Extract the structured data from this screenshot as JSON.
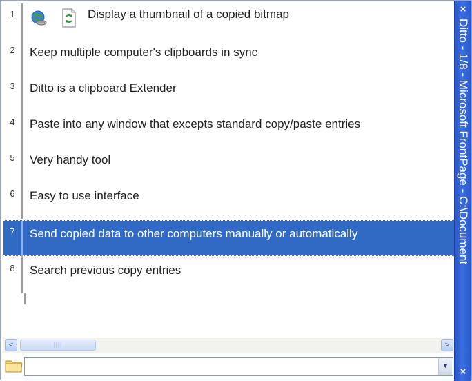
{
  "window": {
    "title": "Ditto - 1/8 - Microsoft FrontPage - C:\\Document",
    "close_top": "×",
    "close_bottom": "×"
  },
  "list": {
    "items": [
      {
        "num": "1",
        "label": "Display a thumbnail of a copied bitmap"
      },
      {
        "num": "2",
        "label": "Keep multiple computer's clipboards in sync"
      },
      {
        "num": "3",
        "label": "Ditto is a clipboard Extender"
      },
      {
        "num": "4",
        "label": "Paste into any window that excepts standard copy/paste entries"
      },
      {
        "num": "5",
        "label": "Very handy tool"
      },
      {
        "num": "6",
        "label": "Easy to use interface"
      },
      {
        "num": "7",
        "label": "Send copied data to other computers manually or automatically"
      },
      {
        "num": "8",
        "label": "Search previous copy entries"
      }
    ],
    "selected_index": 6
  },
  "scrollbar": {
    "left_arrow": "<",
    "right_arrow": ">",
    "thumb_grip": "||||"
  },
  "search": {
    "value": "",
    "placeholder": "",
    "dropdown_arrow": "▼"
  },
  "colors": {
    "selection": "#316ac5",
    "caption": "#2f5fd0"
  },
  "icons": [
    "globe-icon",
    "refresh-document-icon",
    "folder-icon"
  ]
}
